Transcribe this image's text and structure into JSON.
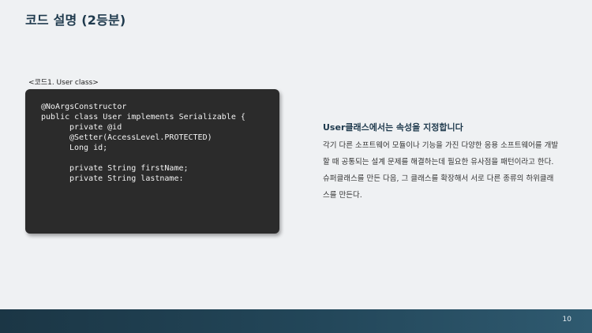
{
  "slide": {
    "title": "코드 설명 (2등분)",
    "page_number": "10"
  },
  "code_section": {
    "caption": "<코드1. User class>",
    "lines": [
      {
        "text": "@NoArgsConstructor",
        "indent": 0
      },
      {
        "text": "public class User implements Serializable {",
        "indent": 0
      },
      {
        "text": "private @id",
        "indent": 1
      },
      {
        "text": "@Setter(AccessLevel.PROTECTED)",
        "indent": 1
      },
      {
        "text": "Long id;",
        "indent": 1
      },
      {
        "text": "",
        "indent": 0
      },
      {
        "text": "private String firstName;",
        "indent": 1
      },
      {
        "text": "private String lastname:",
        "indent": 1
      }
    ]
  },
  "description": {
    "heading": "User클래스에서는  속성을 지정합니다",
    "body": "각기 다른 소프트웨어 모듈이나 기능을 가진 다양한 응용 소프트웨어를 개발 할 때 공통되는 설계 문제를 해결하는데 필요한 유사점을 패턴이라고 한다. 슈퍼클래스를 만든 다음, 그 클래스를 확장해서 서로 다른 종류의 하위클래스를 만든다."
  }
}
